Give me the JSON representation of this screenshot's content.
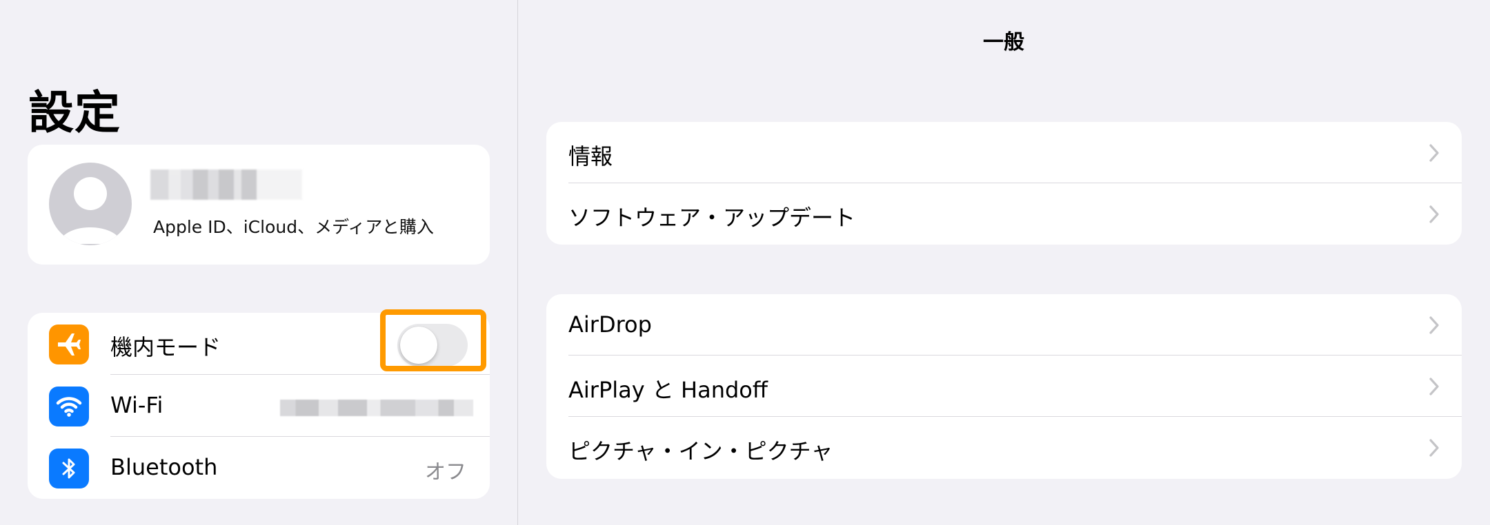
{
  "sidebar": {
    "title": "設定",
    "profile": {
      "subtitle": "Apple ID、iCloud、メディアと購入",
      "avatar_icon": "person-silhouette-icon"
    },
    "items": [
      {
        "label": "機内モード",
        "icon": "airplane-icon",
        "icon_color": "#ff9500",
        "control": "toggle",
        "toggle_on": false,
        "highlight_color": "#ff9a00"
      },
      {
        "label": "Wi-Fi",
        "icon": "wifi-icon",
        "icon_color": "#0a7aff",
        "control": "value-redacted"
      },
      {
        "label": "Bluetooth",
        "icon": "bluetooth-icon",
        "icon_color": "#0a7aff",
        "value": "オフ"
      }
    ]
  },
  "detail": {
    "title": "一般",
    "group1": [
      {
        "label": "情報"
      },
      {
        "label": "ソフトウェア・アップデート"
      }
    ],
    "group2": [
      {
        "label": "AirDrop"
      },
      {
        "label": "AirPlay と Handoff"
      },
      {
        "label": "ピクチャ・イン・ピクチャ"
      }
    ]
  },
  "colors": {
    "background": "#f2f1f6",
    "card": "#ffffff",
    "accent_orange": "#ff9500",
    "accent_blue": "#0a7aff"
  }
}
